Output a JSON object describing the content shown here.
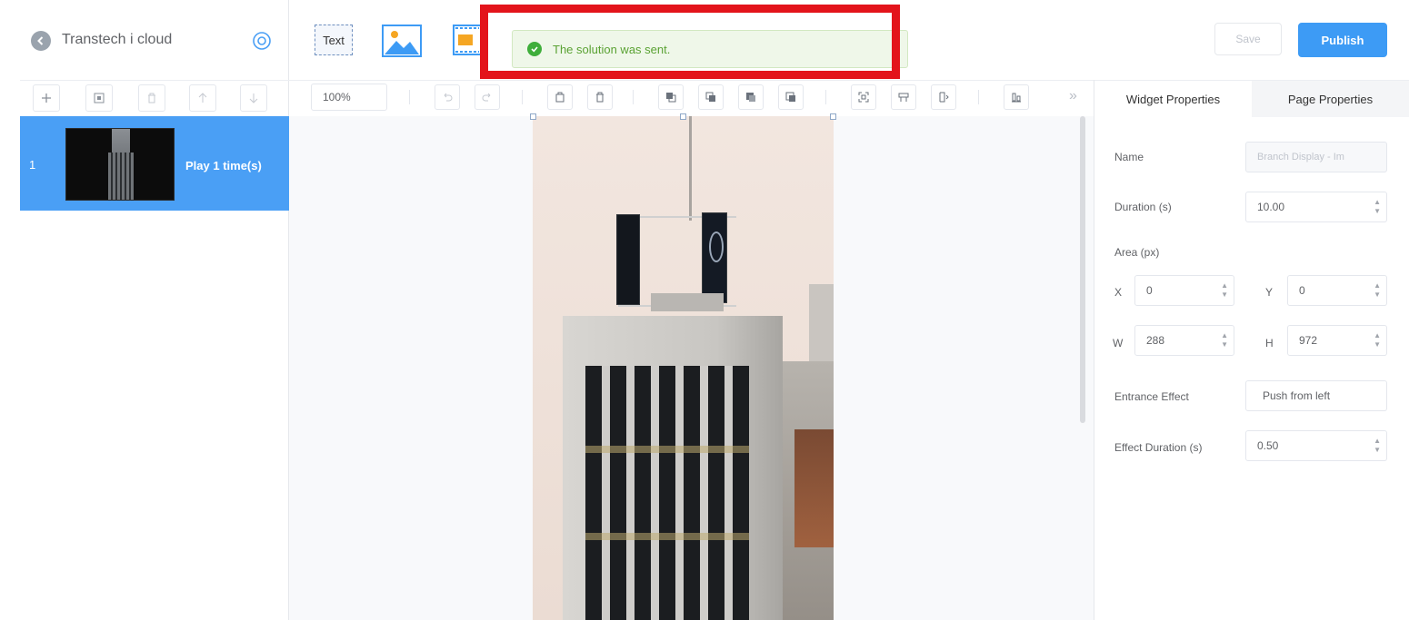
{
  "app": {
    "title": "Transtech i cloud"
  },
  "toolbar": {
    "text_widget_label": "Text",
    "save_label": "Save",
    "publish_label": "Publish"
  },
  "toast": {
    "message": "The solution was sent."
  },
  "edit_toolbar": {
    "zoom": "100%"
  },
  "pages": [
    {
      "number": "1",
      "label": "Play 1 time(s)"
    }
  ],
  "panel": {
    "tabs": [
      "Widget Properties",
      "Page Properties"
    ],
    "name_label": "Name",
    "name_value": "Branch Display - Im",
    "duration_label": "Duration (s)",
    "duration_value": "10.00",
    "area_label": "Area (px)",
    "x_label": "X",
    "x_value": "0",
    "y_label": "Y",
    "y_value": "0",
    "w_label": "W",
    "w_value": "288",
    "h_label": "H",
    "h_value": "972",
    "entrance_label": "Entrance Effect",
    "entrance_value": "Push from left",
    "effect_duration_label": "Effect Duration (s)",
    "effect_duration_value": "0.50"
  },
  "colors": {
    "accent": "#3d9bf5",
    "highlight": "#e3141b",
    "success": "#3fae3b"
  }
}
